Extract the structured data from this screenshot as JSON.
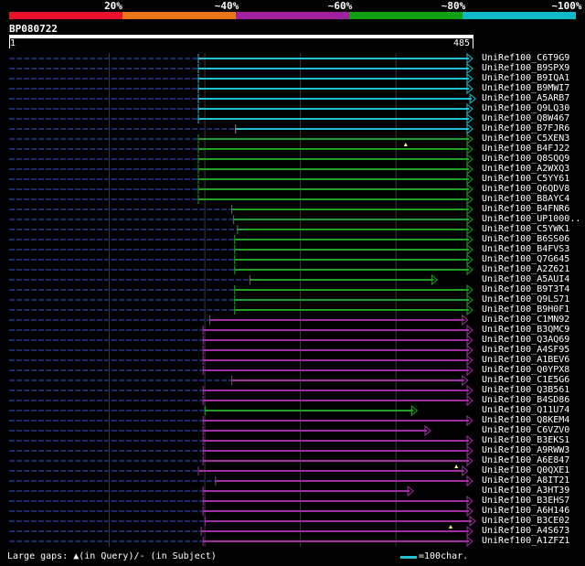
{
  "legend": {
    "colors": [
      "#e8102a",
      "#e87818",
      "#a020a0",
      "#10a010",
      "#10b8c8"
    ],
    "labels": [
      "20%",
      "~40%",
      "~60%",
      "~80%",
      "~100%"
    ]
  },
  "query": {
    "id": "BP080722",
    "start": "1",
    "end": "485"
  },
  "footer": {
    "gaps_text": "Large gaps: ▲(in Query)/- (in Subject)",
    "scale_text": "=100char."
  },
  "hits": [
    {
      "name": "UniRef100_C6T9G9",
      "color": "#20c0d0",
      "start": 198,
      "end": 485,
      "gap": null
    },
    {
      "name": "UniRef100_B9SPX9",
      "color": "#20c0d0",
      "start": 198,
      "end": 485,
      "gap": null
    },
    {
      "name": "UniRef100_B9IQA1",
      "color": "#20c0d0",
      "start": 198,
      "end": 485,
      "gap": null
    },
    {
      "name": "UniRef100_B9MWI7",
      "color": "#20c0d0",
      "start": 198,
      "end": 485,
      "gap": null
    },
    {
      "name": "UniRef100_A5ARB7",
      "color": "#20c0d0",
      "start": 198,
      "end": 488,
      "gap": null
    },
    {
      "name": "UniRef100_Q9LQ30",
      "color": "#20c0d0",
      "start": 198,
      "end": 485,
      "gap": null
    },
    {
      "name": "UniRef100_Q8W467",
      "color": "#20c0d0",
      "start": 198,
      "end": 485,
      "gap": null
    },
    {
      "name": "UniRef100_B7FJR6",
      "color": "#20c0d0",
      "start": 237,
      "end": 485,
      "gap": null
    },
    {
      "name": "UniRef100_C5XEN3",
      "color": "#20a020",
      "start": 198,
      "end": 485,
      "gap": null
    },
    {
      "name": "UniRef100_B4FJ22",
      "color": "#20a020",
      "start": 198,
      "end": 485,
      "gap": 415
    },
    {
      "name": "UniRef100_Q8SQQ9",
      "color": "#20a020",
      "start": 198,
      "end": 485,
      "gap": null
    },
    {
      "name": "UniRef100_A2WXQ3",
      "color": "#20a020",
      "start": 198,
      "end": 485,
      "gap": null
    },
    {
      "name": "UniRef100_C5YY61",
      "color": "#20a020",
      "start": 198,
      "end": 485,
      "gap": null
    },
    {
      "name": "UniRef100_Q6QDV8",
      "color": "#20a020",
      "start": 198,
      "end": 485,
      "gap": null
    },
    {
      "name": "UniRef100_B8AYC4",
      "color": "#20a020",
      "start": 198,
      "end": 485,
      "gap": null
    },
    {
      "name": "UniRef100_B4FNR6",
      "color": "#20a020",
      "start": 233,
      "end": 485,
      "gap": null
    },
    {
      "name": "UniRef100_UP1000..",
      "color": "#20a020",
      "start": 235,
      "end": 485,
      "gap": null
    },
    {
      "name": "UniRef100_C5YWK1",
      "color": "#20a020",
      "start": 239,
      "end": 485,
      "gap": null
    },
    {
      "name": "UniRef100_B6SS06",
      "color": "#20a020",
      "start": 236,
      "end": 485,
      "gap": null
    },
    {
      "name": "UniRef100_B4FVS3",
      "color": "#20a020",
      "start": 236,
      "end": 485,
      "gap": null
    },
    {
      "name": "UniRef100_Q7G645",
      "color": "#20a020",
      "start": 236,
      "end": 485,
      "gap": null
    },
    {
      "name": "UniRef100_A2Z621",
      "color": "#20a020",
      "start": 236,
      "end": 485,
      "gap": null
    },
    {
      "name": "UniRef100_A5AUI4",
      "color": "#20a020",
      "start": 252,
      "end": 448,
      "gap": null
    },
    {
      "name": "UniRef100_B9T3T4",
      "color": "#20a020",
      "start": 236,
      "end": 485,
      "gap": null
    },
    {
      "name": "UniRef100_Q9LS71",
      "color": "#20a020",
      "start": 236,
      "end": 485,
      "gap": null
    },
    {
      "name": "UniRef100_B9H0F1",
      "color": "#20a020",
      "start": 236,
      "end": 485,
      "gap": null
    },
    {
      "name": "UniRef100_C1MN92",
      "color": "#a030a0",
      "start": 210,
      "end": 480,
      "gap": null
    },
    {
      "name": "UniRef100_B3QMC9",
      "color": "#a030a0",
      "start": 203,
      "end": 485,
      "gap": null
    },
    {
      "name": "UniRef100_Q3AQ69",
      "color": "#a030a0",
      "start": 203,
      "end": 485,
      "gap": null
    },
    {
      "name": "UniRef100_A4SF95",
      "color": "#a030a0",
      "start": 203,
      "end": 485,
      "gap": null
    },
    {
      "name": "UniRef100_A1BEV6",
      "color": "#a030a0",
      "start": 203,
      "end": 485,
      "gap": null
    },
    {
      "name": "UniRef100_Q0YPX8",
      "color": "#a030a0",
      "start": 203,
      "end": 485,
      "gap": null
    },
    {
      "name": "UniRef100_C1E5G6",
      "color": "#a030a0",
      "start": 233,
      "end": 480,
      "gap": null
    },
    {
      "name": "UniRef100_Q3B561",
      "color": "#a030a0",
      "start": 203,
      "end": 485,
      "gap": null
    },
    {
      "name": "UniRef100_B4SD86",
      "color": "#a030a0",
      "start": 203,
      "end": 485,
      "gap": null
    },
    {
      "name": "UniRef100_Q11U74",
      "color": "#20a020",
      "start": 205,
      "end": 427,
      "gap": null
    },
    {
      "name": "UniRef100_Q8KEM4",
      "color": "#a030a0",
      "start": 203,
      "end": 485,
      "gap": null
    },
    {
      "name": "UniRef100_C6VZV0",
      "color": "#a030a0",
      "start": 203,
      "end": 441,
      "gap": null
    },
    {
      "name": "UniRef100_B3EKS1",
      "color": "#a030a0",
      "start": 203,
      "end": 485,
      "gap": null
    },
    {
      "name": "UniRef100_A9RWW3",
      "color": "#a030a0",
      "start": 203,
      "end": 485,
      "gap": null
    },
    {
      "name": "UniRef100_A6E847",
      "color": "#a030a0",
      "start": 203,
      "end": 485,
      "gap": null
    },
    {
      "name": "UniRef100_Q0QXE1",
      "color": "#a030a0",
      "start": 198,
      "end": 480,
      "gap": 468
    },
    {
      "name": "UniRef100_A8IT21",
      "color": "#a030a0",
      "start": 216,
      "end": 485,
      "gap": null
    },
    {
      "name": "UniRef100_A3HT39",
      "color": "#a030a0",
      "start": 203,
      "end": 423,
      "gap": null
    },
    {
      "name": "UniRef100_B3EHS7",
      "color": "#a030a0",
      "start": 203,
      "end": 485,
      "gap": null
    },
    {
      "name": "UniRef100_A6H146",
      "color": "#a030a0",
      "start": 203,
      "end": 485,
      "gap": null
    },
    {
      "name": "UniRef100_B3CE02",
      "color": "#a030a0",
      "start": 205,
      "end": 488,
      "gap": null
    },
    {
      "name": "UniRef100_A4S673",
      "color": "#a030a0",
      "start": 201,
      "end": 485,
      "gap": 462
    },
    {
      "name": "UniRef100_A1ZFZ1",
      "color": "#a030a0",
      "start": 203,
      "end": 485,
      "gap": null
    }
  ]
}
